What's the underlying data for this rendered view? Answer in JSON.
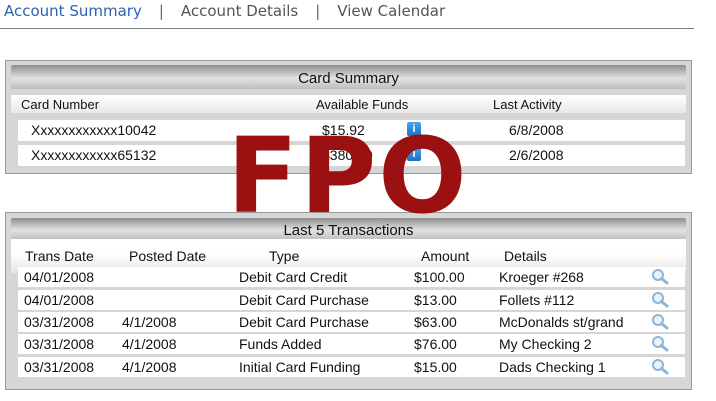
{
  "nav": {
    "tabs": [
      {
        "label": "Account Summary"
      },
      {
        "label": "Account Details"
      },
      {
        "label": "View Calendar"
      }
    ],
    "separator": "|"
  },
  "card_summary": {
    "title": "Card Summary",
    "columns": [
      "Card Number",
      "Available Funds",
      "Last Activity"
    ],
    "rows": [
      {
        "card_number": "Xxxxxxxxxxxx10042",
        "available_funds": "$15.92",
        "last_activity": "6/8/2008"
      },
      {
        "card_number": "Xxxxxxxxxxxx65132",
        "available_funds": "$380.00",
        "last_activity": "2/6/2008"
      }
    ]
  },
  "transactions": {
    "title": "Last 5 Transactions",
    "columns": [
      "Trans Date",
      "Posted Date",
      "Type",
      "Amount",
      "Details"
    ],
    "rows": [
      {
        "trans_date": "04/01/2008",
        "posted_date": "",
        "type": "Debit Card Credit",
        "amount": "$100.00",
        "details": "Kroeger #268"
      },
      {
        "trans_date": "04/01/2008",
        "posted_date": "",
        "type": "Debit Card Purchase",
        "amount": "$13.00",
        "details": "Follets #112"
      },
      {
        "trans_date": "03/31/2008",
        "posted_date": "4/1/2008",
        "type": "Debit Card Purchase",
        "amount": "$63.00",
        "details": "McDonalds st/grand"
      },
      {
        "trans_date": "03/31/2008",
        "posted_date": "4/1/2008",
        "type": "Funds Added",
        "amount": "$76.00",
        "details": "My Checking 2"
      },
      {
        "trans_date": "03/31/2008",
        "posted_date": "4/1/2008",
        "type": "Initial Card Funding",
        "amount": "$15.00",
        "details": "Dads Checking 1"
      }
    ]
  },
  "watermark": {
    "text": "FPO"
  },
  "icons": {
    "info": "info-icon",
    "details": "magnifier-icon"
  },
  "colors": {
    "active_tab": "#2a63b5",
    "watermark": "#9b1010"
  }
}
